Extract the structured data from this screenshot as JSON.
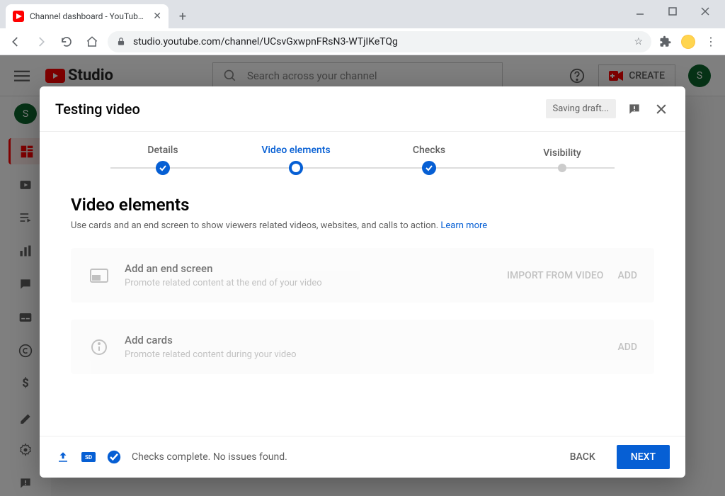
{
  "browser": {
    "tab_title": "Channel dashboard - YouTube St",
    "url": "studio.youtube.com/channel/UCsvGxwpnFRsN3-WTjIKeTQg"
  },
  "studio_header": {
    "logo_text": "Studio",
    "search_placeholder": "Search across your channel",
    "create_label": "CREATE",
    "avatar_initial": "S"
  },
  "left_rail": {
    "avatar_initial": "S"
  },
  "modal": {
    "title": "Testing video",
    "status_chip": "Saving draft...",
    "steps": [
      {
        "label": "Details",
        "state": "done"
      },
      {
        "label": "Video elements",
        "state": "current"
      },
      {
        "label": "Checks",
        "state": "done"
      },
      {
        "label": "Visibility",
        "state": "future"
      }
    ],
    "section_title": "Video elements",
    "section_desc": "Use cards and an end screen to show viewers related videos, websites, and calls to action. ",
    "learn_more": "Learn more",
    "cards": [
      {
        "title": "Add an end screen",
        "subtitle": "Promote related content at the end of your video",
        "actions": [
          "IMPORT FROM VIDEO",
          "ADD"
        ],
        "disabled": true
      },
      {
        "title": "Add cards",
        "subtitle": "Promote related content during your video",
        "actions": [
          "ADD"
        ],
        "disabled": true
      }
    ],
    "footer_status": "Checks complete. No issues found.",
    "back_label": "BACK",
    "next_label": "NEXT"
  }
}
